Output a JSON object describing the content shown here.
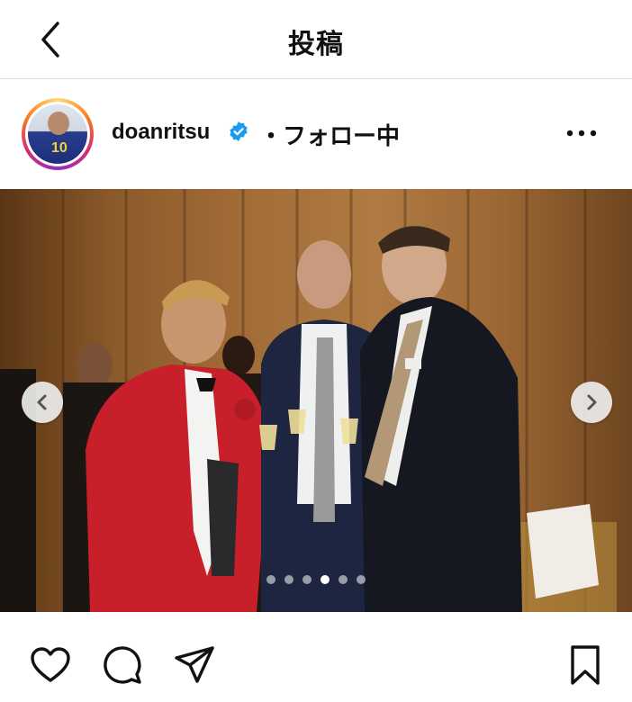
{
  "topbar": {
    "title": "投稿"
  },
  "post": {
    "username": "doanritsu",
    "separator": "・",
    "follow_status": "フォロー中",
    "avatar_number": "10",
    "carousel": {
      "total": 6,
      "current": 4
    }
  },
  "icons": {
    "back": "chevron-left-icon",
    "verified": "verified-badge-icon",
    "more": "more-horizontal-icon",
    "prev": "chevron-left-icon",
    "next": "chevron-right-icon",
    "like": "heart-icon",
    "comment": "comment-icon",
    "share": "send-icon",
    "save": "bookmark-icon"
  },
  "colors": {
    "verified": "#1a9bf0",
    "accent": "#111111"
  }
}
